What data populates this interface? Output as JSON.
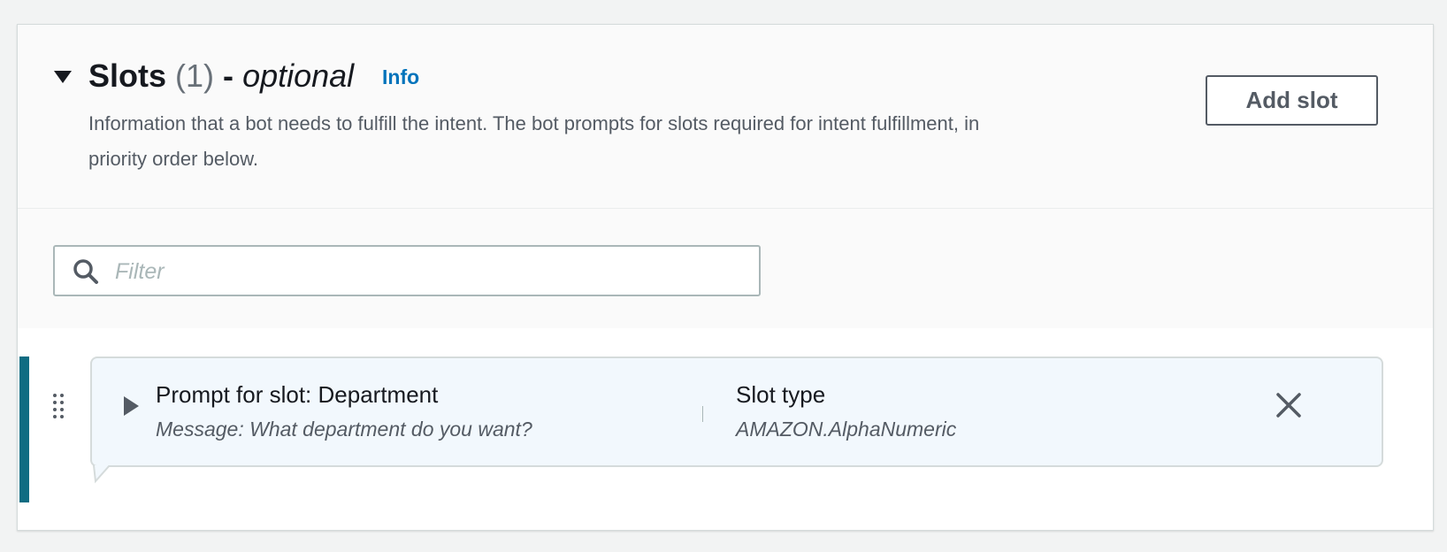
{
  "section": {
    "title": "Slots",
    "count": "(1)",
    "separator": "-",
    "optional_label": "optional",
    "info_link": "Info",
    "description": "Information that a bot needs to fulfill the intent. The bot prompts for slots required for intent fulfillment, in priority order below.",
    "add_button": "Add slot"
  },
  "filter": {
    "placeholder": "Filter",
    "value": ""
  },
  "slots": [
    {
      "prompt_title": "Prompt for slot: Department",
      "message": "Message: What department do you want?",
      "type_label": "Slot type",
      "type_value": "AMAZON.AlphaNumeric"
    }
  ],
  "colors": {
    "accent_bar": "#0f6c82",
    "info_link": "#0073bb",
    "card_background": "#f2f8fd"
  },
  "icons": {
    "collapse": "caret-down-icon",
    "search": "search-icon",
    "drag": "drag-handle-icon",
    "expand": "caret-right-icon",
    "close": "close-icon"
  }
}
